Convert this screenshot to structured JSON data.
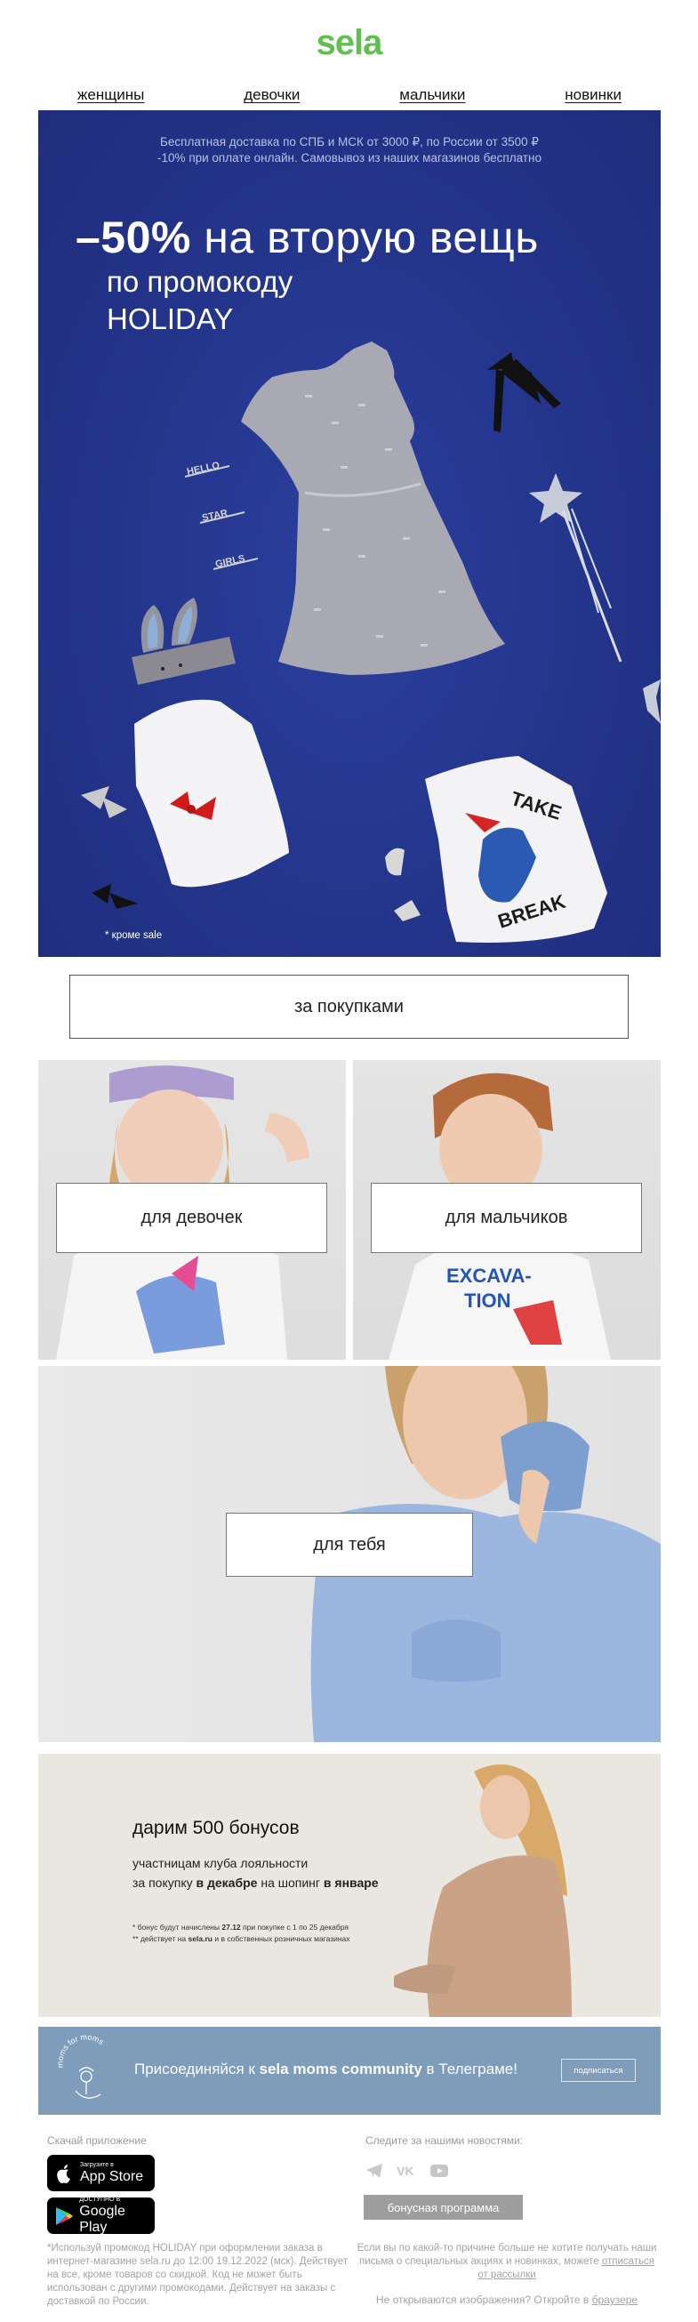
{
  "brand": {
    "logo": "sela",
    "accent": "#61bf4f"
  },
  "nav": [
    {
      "label": "женщины"
    },
    {
      "label": "девочки"
    },
    {
      "label": "мальчики"
    },
    {
      "label": "новинки"
    }
  ],
  "hero": {
    "info_line1": "Бесплатная доставка по СПБ и МСК от 3000 ₽, по России от 3500 ₽",
    "info_line2": "-10% при оплате онлайн. Самовывоз из наших магазинов бесплатно",
    "headline_discount": "–50%",
    "headline_rest": "на вторую вещь",
    "subline1": "по промокоду",
    "subline2": "HOLIDAY",
    "footnote": "* кроме sale",
    "clips": [
      "HELLO",
      "STAR",
      "GIRLS"
    ],
    "bg": "#24348a"
  },
  "shop_button": "за покупками",
  "tiles": {
    "girls": "для девочек",
    "boys": "для мальчиков",
    "you": "для тебя"
  },
  "bonus": {
    "title": "дарим 500 бонусов",
    "line1": "участницам клуба лояльности",
    "line2_pre": "за покупку",
    "line2_b1": "в декабре",
    "line2_mid": "на шопинг",
    "line2_b2": "в январе",
    "fn1_pre": "* бонус будут начислены",
    "fn1_b": "27.12",
    "fn1_post": "при покупке с 1 по 25 декабря",
    "fn2_pre": "** действует на",
    "fn2_b": "sela.ru",
    "fn2_post": "и в собственных розничных магазинах"
  },
  "moms": {
    "logo_text": "moms for moms",
    "pre": "Присоединяйся к",
    "bold": "sela moms community",
    "post": "в Телеграме!",
    "button": "подписаться",
    "bg": "#7d9dbb"
  },
  "footer": {
    "apps_label": "Скачай приложение",
    "appstore_small": "Загрузите в",
    "appstore_big": "App Store",
    "gplay_small": "ДОСТУПНО В",
    "gplay_big": "Google Play",
    "news_label": "Следите за нашими новостями:",
    "social": [
      "telegram-icon",
      "vk-icon",
      "youtube-icon"
    ],
    "bonus_program": "бонусная программа",
    "disclaimer": "*Используй промокод HOLIDAY при оформлении заказа в интернет-магазине sela.ru до 12:00 19.12.2022 (мск). Действует на все, кроме товаров со скидкой. Код не может быть использован с другими промокодами. Действует на заказы с доставкой по России.",
    "unsub_text": "Если вы по какой-то причине больше не хотите получать наши письма о специальных акциях и новинках, можете",
    "unsub_link": "отписаться от рассылки",
    "images_text": "Не открываются изображения? Откройте в",
    "images_link": "браузере"
  }
}
